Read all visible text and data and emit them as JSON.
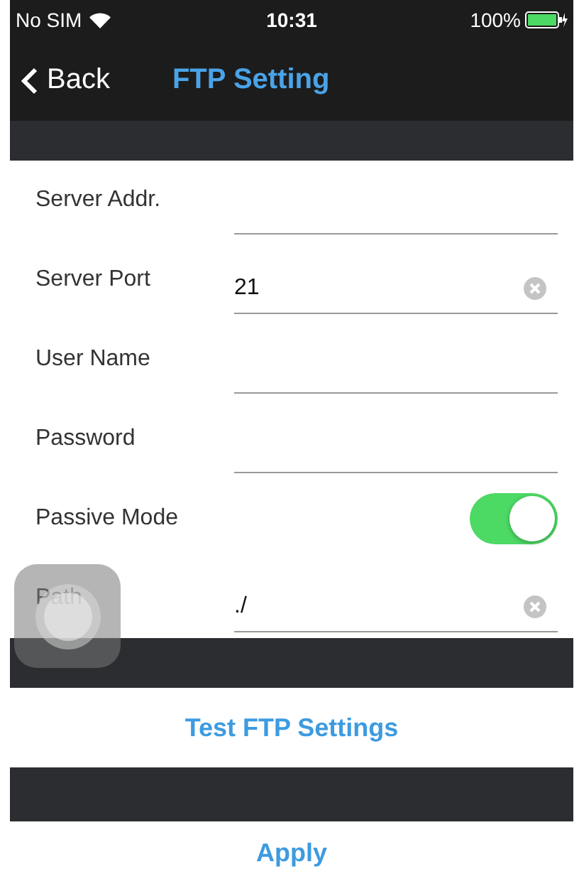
{
  "status_bar": {
    "carrier": "No SIM",
    "time": "10:31",
    "battery": "100%"
  },
  "nav_bar": {
    "back": "Back",
    "title": "FTP Setting"
  },
  "fields": [
    {
      "kind": "text",
      "label": "Server Addr."
    },
    {
      "kind": "text",
      "label": "Server Port",
      "value": "21"
    },
    {
      "kind": "text",
      "label": "User Name"
    },
    {
      "kind": "text",
      "label": "Password"
    },
    {
      "kind": "switch",
      "label": "Passive Mode",
      "on": true
    },
    {
      "kind": "text",
      "label": "Path",
      "value": "./"
    }
  ],
  "buttons": [
    "Test FTP Settings",
    "Apply"
  ]
}
